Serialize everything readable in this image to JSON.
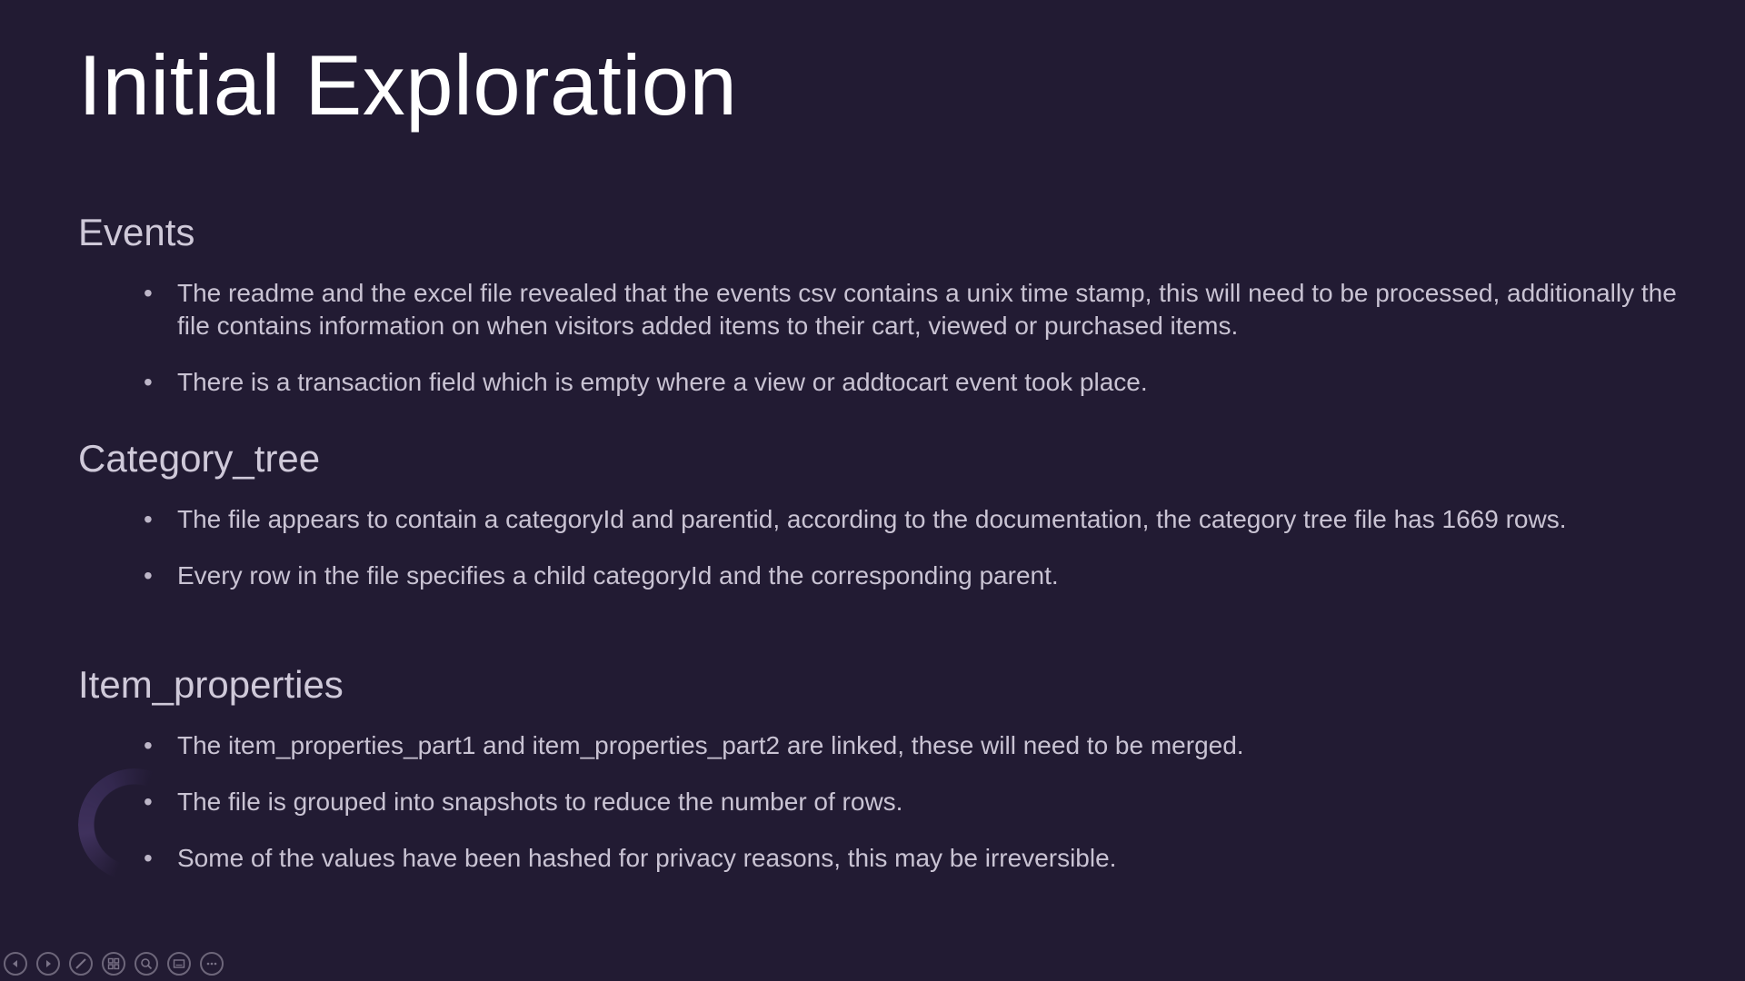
{
  "slide": {
    "title": "Initial Exploration",
    "sections": [
      {
        "heading": "Events",
        "bullets": [
          "The readme and the excel file revealed that the events csv contains a unix time stamp, this will need to be processed, additionally the file contains information on when visitors added items to their cart, viewed or purchased items.",
          "There is a transaction field which is empty where a view or addtocart event took place."
        ]
      },
      {
        "heading": "Category_tree",
        "bullets": [
          "The file appears to contain a categoryId and parentid, according to the documentation, the category tree file has 1669 rows.",
          "Every row in the file specifies a child categoryId and the corresponding parent."
        ]
      },
      {
        "heading": "Item_properties",
        "bullets": [
          "The item_properties_part1 and item_properties_part2 are linked, these will need to be merged.",
          "The file is grouped into snapshots to reduce the number of rows.",
          "Some of the values have been hashed for privacy reasons, this may be irreversible."
        ]
      }
    ],
    "bullet_symbol": "•"
  },
  "toolbar": {
    "icons": [
      "previous-icon",
      "next-icon",
      "pen-icon",
      "slides-grid-icon",
      "zoom-icon",
      "subtitles-icon",
      "more-options-icon"
    ]
  },
  "colors": {
    "background": "#221b33",
    "title": "#ffffff",
    "heading": "#cfc9d9",
    "body": "#c9c3d3"
  }
}
